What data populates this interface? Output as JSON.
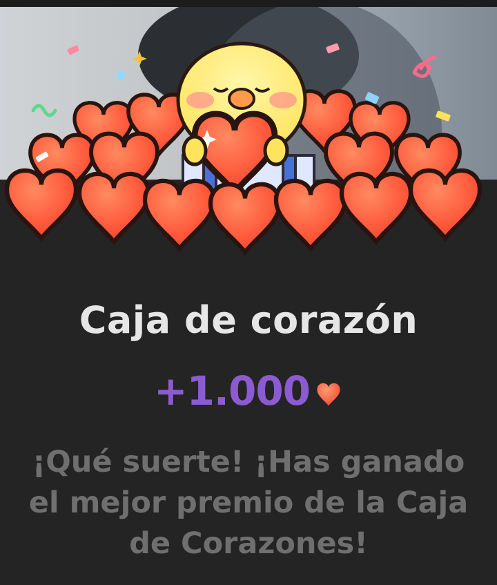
{
  "reward_dialog": {
    "title": "Caja de corazón",
    "reward_amount": "+1.000",
    "reward_icon": "heart-icon",
    "message": "¡Qué suerte! ¡Has ganado el mejor premio de la Caja de Corazones!"
  },
  "illustration": {
    "subject": "duck mascot holding heart over pile of hearts",
    "accent_color": "#ff5a3c",
    "reward_color": "#8c5bd1"
  }
}
